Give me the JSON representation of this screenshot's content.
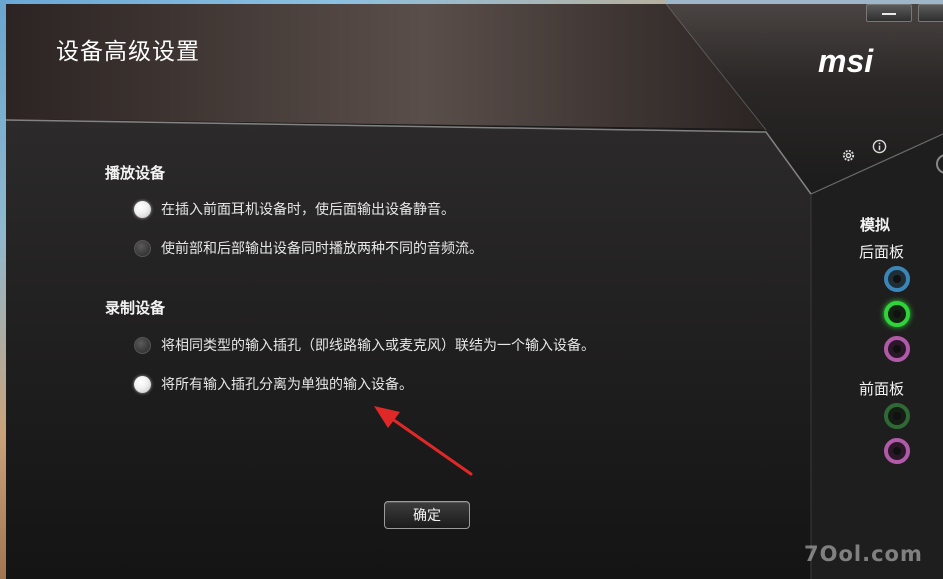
{
  "window": {
    "title": "设备高级设置",
    "brand": "msi"
  },
  "playback": {
    "heading": "播放设备",
    "options": [
      {
        "label": "在插入前面耳机设备时，使后面输出设备静音。",
        "selected": true
      },
      {
        "label": "使前部和后部输出设备同时播放两种不同的音频流。",
        "selected": false
      }
    ]
  },
  "recording": {
    "heading": "录制设备",
    "options": [
      {
        "label": "将相同类型的输入插孔（即线路输入或麦克风）联结为一个输入设备。",
        "selected": false
      },
      {
        "label": "将所有输入插孔分离为单独的输入设备。",
        "selected": true
      }
    ]
  },
  "side_panel": {
    "mode": "模拟",
    "rear_label": "后面板",
    "front_label": "前面板",
    "rear_jacks": [
      "blue",
      "green-active",
      "pink"
    ],
    "front_jacks": [
      "green-dim",
      "pink"
    ]
  },
  "buttons": {
    "ok": "确定"
  },
  "icons": {
    "gear": "gear-icon",
    "info": "info-icon",
    "minimize": "minimize-icon",
    "close": "close-icon"
  },
  "colors": {
    "accent_green": "#2fd33a",
    "jack_blue": "#3a86b8",
    "jack_pink": "#b05aa8",
    "annotation_red": "#e02828"
  },
  "watermark": "7Ool.com"
}
